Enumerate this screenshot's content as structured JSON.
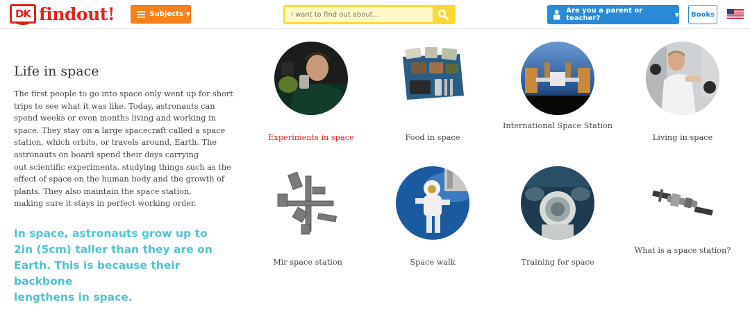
{
  "header": {
    "logo_box": "DK",
    "logo_word": "findout!",
    "subjects_label": "Subjects",
    "search_placeholder": "I want to find out about...",
    "parent_label": "Are you a parent or teacher?",
    "books_label": "Books"
  },
  "article": {
    "title": "Life in space",
    "intro": "The first people to go into space only went up for short\ntrips to see what it was like. Today, astronauts can\nspend weeks or even months living and working in\nspace. They stay on a large spacecraft called a space\nstation, which orbits, or travels around, Earth. The\nastronauts on board spend their days carrying\nout scientific experiments, studying things such as the\neffect of space on the human body and the growth of\nplants. They also maintain the space station,\nmaking sure it stays in perfect working order.",
    "fact": "In space, astronauts grow up to\n2in (5cm) taller than they are on\nEarth. This is because their backbone\nlengthens in space."
  },
  "topics": [
    {
      "label": "Experiments in space",
      "active": true
    },
    {
      "label": "Food in space",
      "active": false
    },
    {
      "label": "International Space Station",
      "active": false
    },
    {
      "label": "Living in space",
      "active": false
    },
    {
      "label": "Mir space station",
      "active": false
    },
    {
      "label": "Space walk",
      "active": false
    },
    {
      "label": "Training for space",
      "active": false
    },
    {
      "label": "What is a space station?",
      "active": false
    }
  ],
  "colors": {
    "brand_red": "#e32319",
    "subjects_orange": "#f7821b",
    "search_yellow": "#fdd835",
    "parent_blue": "#2a8ad8",
    "fact_teal": "#4ec3d3"
  },
  "icons": [
    "dk-logo",
    "hamburger-icon",
    "chevron-down-icon",
    "search-icon",
    "person-icon",
    "us-flag-icon"
  ]
}
